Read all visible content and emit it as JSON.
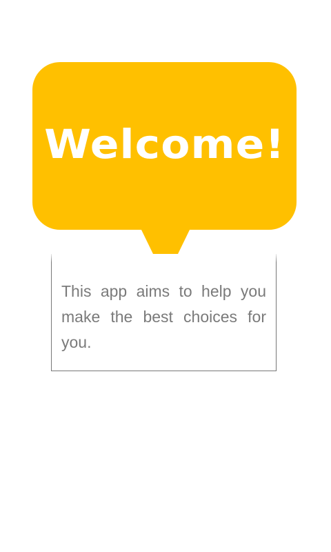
{
  "welcome": {
    "title": "Welcome!",
    "bubble_color": "#FFC000"
  },
  "description": {
    "text": "This app aims to help you make the best choices for you."
  }
}
